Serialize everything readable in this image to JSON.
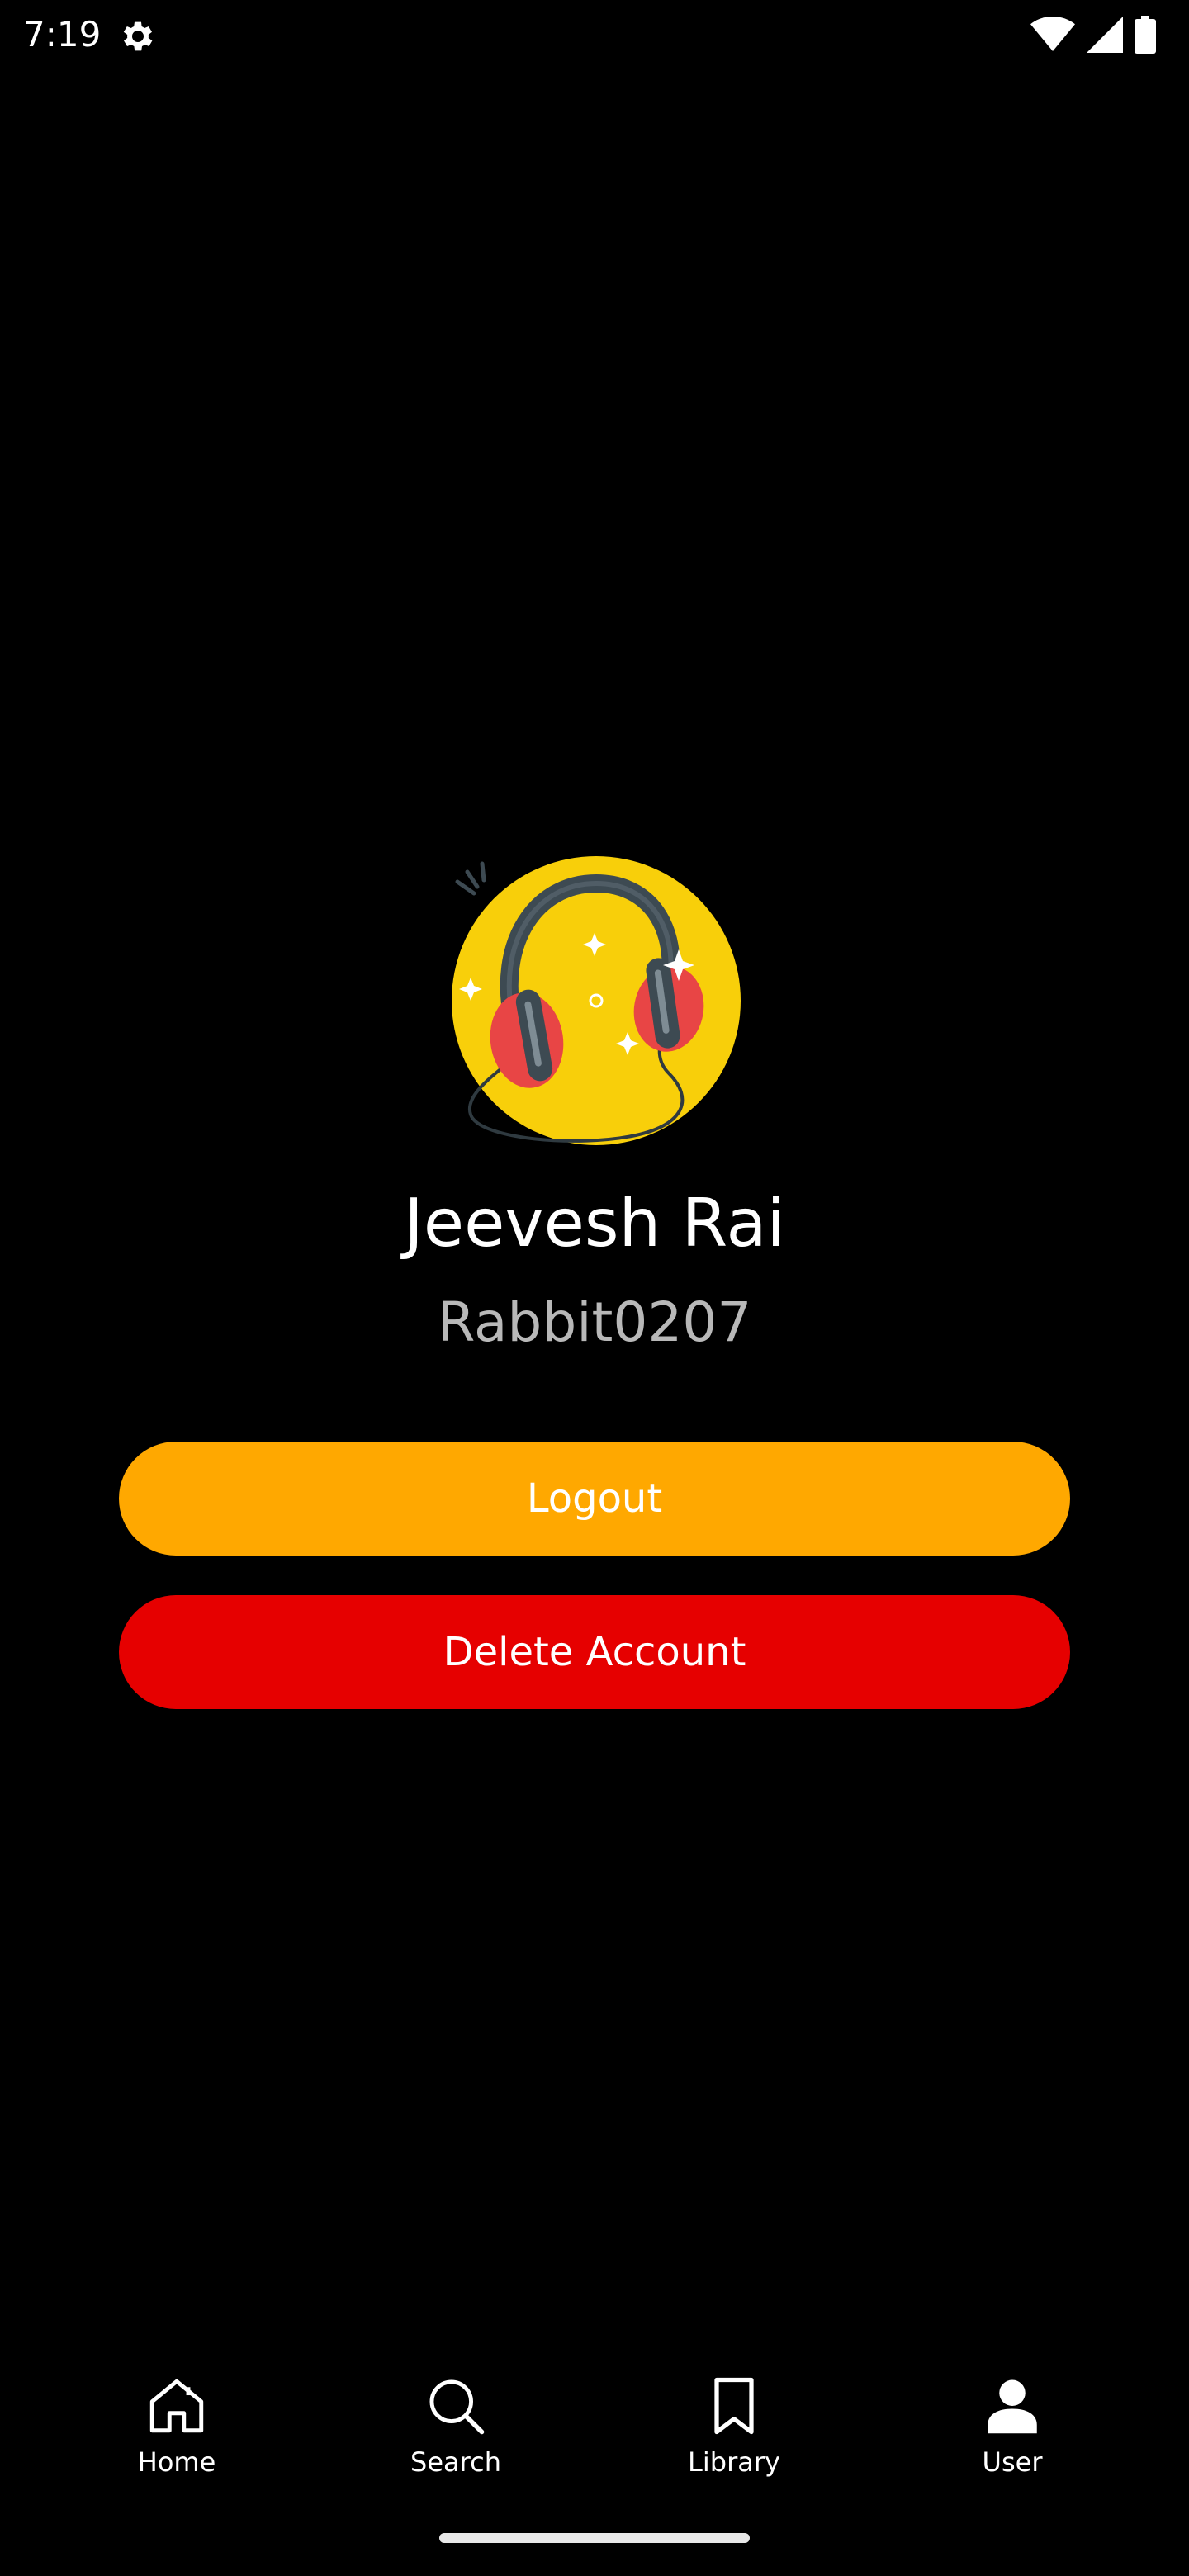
{
  "status_bar": {
    "time": "7:19",
    "icons": [
      "settings-icon",
      "wifi-icon",
      "signal-icon",
      "battery-icon"
    ]
  },
  "profile": {
    "avatar": "headphones-avatar",
    "name": "Jeevesh Rai",
    "username": "Rabbit0207"
  },
  "actions": {
    "logout_label": "Logout",
    "delete_label": "Delete Account"
  },
  "bottom_nav": {
    "items": [
      {
        "label": "Home",
        "icon": "home-icon",
        "active": false
      },
      {
        "label": "Search",
        "icon": "search-icon",
        "active": false
      },
      {
        "label": "Library",
        "icon": "bookmark-icon",
        "active": false
      },
      {
        "label": "User",
        "icon": "user-icon",
        "active": true
      }
    ]
  },
  "colors": {
    "background": "#000000",
    "logout_button": "#ffa800",
    "delete_button": "#e60000",
    "username_text": "#b8b8b8",
    "avatar_yellow": "#f8cf0a",
    "earcup_red": "#e84545"
  }
}
